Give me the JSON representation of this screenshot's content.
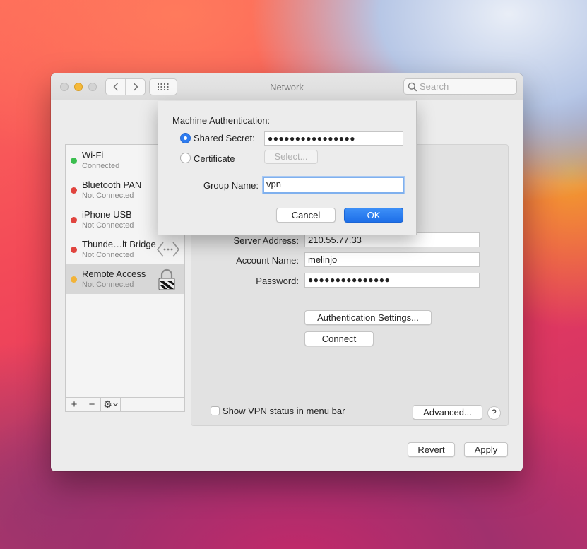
{
  "window": {
    "title": "Network",
    "search_placeholder": "Search"
  },
  "services": [
    {
      "name": "Wi-Fi",
      "status": "Connected",
      "dot_color": "#3bbe4f"
    },
    {
      "name": "Bluetooth PAN",
      "status": "Not Connected",
      "dot_color": "#e0443e"
    },
    {
      "name": "iPhone USB",
      "status": "Not Connected",
      "dot_color": "#e0443e"
    },
    {
      "name": "Thunde…lt Bridge",
      "status": "Not Connected",
      "dot_color": "#e0443e",
      "icon": "thunderbolt-bridge-icon"
    },
    {
      "name": "Remote Access",
      "status": "Not Connected",
      "dot_color": "#f2b338",
      "icon": "vpn-lock-icon",
      "selected": true
    }
  ],
  "sidebar_toolbar": {
    "add": "+",
    "remove": "−",
    "gear": "⚙"
  },
  "vpn": {
    "server_address_label": "Server Address:",
    "server_address": "210.55.77.33",
    "account_name_label": "Account Name:",
    "account_name": "melinjo",
    "password_label": "Password:",
    "password_dots": "●●●●●●●●●●●●●●●",
    "auth_settings_button": "Authentication Settings...",
    "connect_button": "Connect",
    "show_status_label": "Show VPN status in menu bar",
    "show_status_checked": false,
    "advanced_button": "Advanced...",
    "help_button": "?"
  },
  "footer": {
    "revert": "Revert",
    "apply": "Apply"
  },
  "sheet": {
    "heading": "Machine Authentication:",
    "shared_secret_label": "Shared Secret:",
    "shared_secret_dots": "●●●●●●●●●●●●●●●●",
    "certificate_label": "Certificate",
    "select_button": "Select...",
    "group_name_label": "Group Name:",
    "group_name_value": "vpn",
    "cancel_button": "Cancel",
    "ok_button": "OK",
    "selected_option": "shared_secret",
    "accent_color": "#2e7cf0"
  }
}
